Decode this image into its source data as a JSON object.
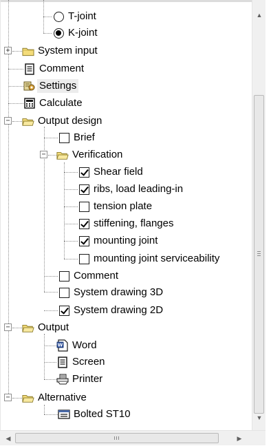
{
  "tree": {
    "t_joint": "T-joint",
    "k_joint": "K-joint",
    "system_input": "System input",
    "comment_top": "Comment",
    "settings": "Settings",
    "calculate": "Calculate",
    "output_design": "Output design",
    "brief": "Brief",
    "verification": "Verification",
    "shear_field": "Shear field",
    "ribs_load": "ribs, load leading-in",
    "tension_plate": "tension plate",
    "stiffening": "stiffening, flanges",
    "mounting_joint": "mounting joint",
    "mounting_joint_serv": "mounting joint serviceability",
    "comment": "Comment",
    "system_drawing_3d": "System drawing 3D",
    "system_drawing_2d": "System drawing 2D",
    "output": "Output",
    "word": "Word",
    "screen": "Screen",
    "printer": "Printer",
    "alternative": "Alternative",
    "bolted": "Bolted ST10"
  },
  "state": {
    "radio_selected": "K-joint",
    "checked": [
      "Shear field",
      "ribs, load leading-in",
      "stiffening, flanges",
      "mounting joint",
      "System drawing 2D"
    ],
    "unchecked": [
      "Brief",
      "tension plate",
      "mounting joint serviceability",
      "Comment",
      "System drawing 3D"
    ],
    "selected_node": "Settings"
  },
  "icons": [
    "radio-icon",
    "folder-icon",
    "document-icon",
    "settings-icon",
    "calculator-icon",
    "checkbox-icon",
    "word-icon",
    "printer-icon",
    "form-icon",
    "expand-icon",
    "collapse-icon"
  ],
  "scrollbar": {
    "h_thumb_grip": "III",
    "v_thumb_grip": "≡"
  }
}
